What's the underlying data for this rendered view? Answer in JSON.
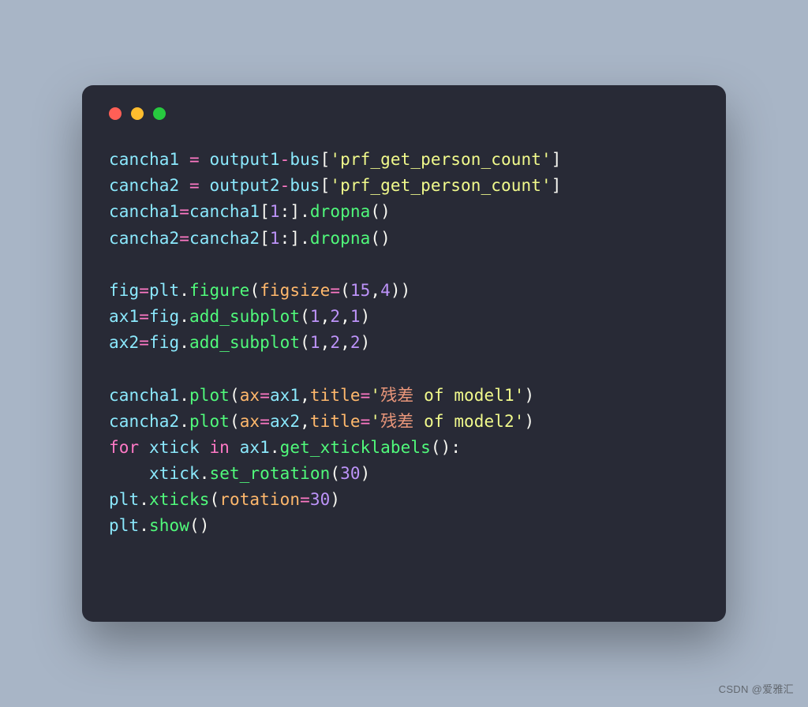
{
  "watermark": "CSDN @爱雅汇",
  "code": {
    "lines": [
      [
        {
          "t": "cancha1 ",
          "c": "c-ident"
        },
        {
          "t": "=",
          "c": "c-op"
        },
        {
          "t": " output1",
          "c": "c-ident"
        },
        {
          "t": "-",
          "c": "c-op"
        },
        {
          "t": "bus",
          "c": "c-ident"
        },
        {
          "t": "[",
          "c": "c-def"
        },
        {
          "t": "'prf_get_person_count'",
          "c": "c-str"
        },
        {
          "t": "]",
          "c": "c-def"
        }
      ],
      [
        {
          "t": "cancha2 ",
          "c": "c-ident"
        },
        {
          "t": "=",
          "c": "c-op"
        },
        {
          "t": " output2",
          "c": "c-ident"
        },
        {
          "t": "-",
          "c": "c-op"
        },
        {
          "t": "bus",
          "c": "c-ident"
        },
        {
          "t": "[",
          "c": "c-def"
        },
        {
          "t": "'prf_get_person_count'",
          "c": "c-str"
        },
        {
          "t": "]",
          "c": "c-def"
        }
      ],
      [
        {
          "t": "cancha1",
          "c": "c-ident"
        },
        {
          "t": "=",
          "c": "c-op"
        },
        {
          "t": "cancha1",
          "c": "c-ident"
        },
        {
          "t": "[",
          "c": "c-def"
        },
        {
          "t": "1",
          "c": "c-num"
        },
        {
          "t": ":].",
          "c": "c-def"
        },
        {
          "t": "dropna",
          "c": "c-call"
        },
        {
          "t": "()",
          "c": "c-def"
        }
      ],
      [
        {
          "t": "cancha2",
          "c": "c-ident"
        },
        {
          "t": "=",
          "c": "c-op"
        },
        {
          "t": "cancha2",
          "c": "c-ident"
        },
        {
          "t": "[",
          "c": "c-def"
        },
        {
          "t": "1",
          "c": "c-num"
        },
        {
          "t": ":].",
          "c": "c-def"
        },
        {
          "t": "dropna",
          "c": "c-call"
        },
        {
          "t": "()",
          "c": "c-def"
        }
      ],
      [],
      [
        {
          "t": "fig",
          "c": "c-ident"
        },
        {
          "t": "=",
          "c": "c-op"
        },
        {
          "t": "plt",
          "c": "c-ident"
        },
        {
          "t": ".",
          "c": "c-def"
        },
        {
          "t": "figure",
          "c": "c-call"
        },
        {
          "t": "(",
          "c": "c-def"
        },
        {
          "t": "figsize",
          "c": "c-kwarg"
        },
        {
          "t": "=",
          "c": "c-op"
        },
        {
          "t": "(",
          "c": "c-def"
        },
        {
          "t": "15",
          "c": "c-num"
        },
        {
          "t": ",",
          "c": "c-def"
        },
        {
          "t": "4",
          "c": "c-num"
        },
        {
          "t": "))",
          "c": "c-def"
        }
      ],
      [
        {
          "t": "ax1",
          "c": "c-ident"
        },
        {
          "t": "=",
          "c": "c-op"
        },
        {
          "t": "fig",
          "c": "c-ident"
        },
        {
          "t": ".",
          "c": "c-def"
        },
        {
          "t": "add_subplot",
          "c": "c-call"
        },
        {
          "t": "(",
          "c": "c-def"
        },
        {
          "t": "1",
          "c": "c-num"
        },
        {
          "t": ",",
          "c": "c-def"
        },
        {
          "t": "2",
          "c": "c-num"
        },
        {
          "t": ",",
          "c": "c-def"
        },
        {
          "t": "1",
          "c": "c-num"
        },
        {
          "t": ")",
          "c": "c-def"
        }
      ],
      [
        {
          "t": "ax2",
          "c": "c-ident"
        },
        {
          "t": "=",
          "c": "c-op"
        },
        {
          "t": "fig",
          "c": "c-ident"
        },
        {
          "t": ".",
          "c": "c-def"
        },
        {
          "t": "add_subplot",
          "c": "c-call"
        },
        {
          "t": "(",
          "c": "c-def"
        },
        {
          "t": "1",
          "c": "c-num"
        },
        {
          "t": ",",
          "c": "c-def"
        },
        {
          "t": "2",
          "c": "c-num"
        },
        {
          "t": ",",
          "c": "c-def"
        },
        {
          "t": "2",
          "c": "c-num"
        },
        {
          "t": ")",
          "c": "c-def"
        }
      ],
      [],
      [
        {
          "t": "cancha1",
          "c": "c-ident"
        },
        {
          "t": ".",
          "c": "c-def"
        },
        {
          "t": "plot",
          "c": "c-call"
        },
        {
          "t": "(",
          "c": "c-def"
        },
        {
          "t": "ax",
          "c": "c-kwarg"
        },
        {
          "t": "=",
          "c": "c-op"
        },
        {
          "t": "ax1",
          "c": "c-ident"
        },
        {
          "t": ",",
          "c": "c-def"
        },
        {
          "t": "title",
          "c": "c-kwarg"
        },
        {
          "t": "=",
          "c": "c-op"
        },
        {
          "t": "'",
          "c": "c-str"
        },
        {
          "t": "残差",
          "c": "c-strz"
        },
        {
          "t": " of model1'",
          "c": "c-str"
        },
        {
          "t": ")",
          "c": "c-def"
        }
      ],
      [
        {
          "t": "cancha2",
          "c": "c-ident"
        },
        {
          "t": ".",
          "c": "c-def"
        },
        {
          "t": "plot",
          "c": "c-call"
        },
        {
          "t": "(",
          "c": "c-def"
        },
        {
          "t": "ax",
          "c": "c-kwarg"
        },
        {
          "t": "=",
          "c": "c-op"
        },
        {
          "t": "ax2",
          "c": "c-ident"
        },
        {
          "t": ",",
          "c": "c-def"
        },
        {
          "t": "title",
          "c": "c-kwarg"
        },
        {
          "t": "=",
          "c": "c-op"
        },
        {
          "t": "'",
          "c": "c-str"
        },
        {
          "t": "残差",
          "c": "c-strz"
        },
        {
          "t": " of model2'",
          "c": "c-str"
        },
        {
          "t": ")",
          "c": "c-def"
        }
      ],
      [
        {
          "t": "for",
          "c": "c-op"
        },
        {
          "t": " xtick ",
          "c": "c-ident"
        },
        {
          "t": "in",
          "c": "c-op"
        },
        {
          "t": " ax1",
          "c": "c-ident"
        },
        {
          "t": ".",
          "c": "c-def"
        },
        {
          "t": "get_xticklabels",
          "c": "c-call"
        },
        {
          "t": "():",
          "c": "c-def"
        }
      ],
      [
        {
          "t": "    xtick",
          "c": "c-ident"
        },
        {
          "t": ".",
          "c": "c-def"
        },
        {
          "t": "set_rotation",
          "c": "c-call"
        },
        {
          "t": "(",
          "c": "c-def"
        },
        {
          "t": "30",
          "c": "c-num"
        },
        {
          "t": ")",
          "c": "c-def"
        }
      ],
      [
        {
          "t": "plt",
          "c": "c-ident"
        },
        {
          "t": ".",
          "c": "c-def"
        },
        {
          "t": "xticks",
          "c": "c-call"
        },
        {
          "t": "(",
          "c": "c-def"
        },
        {
          "t": "rotation",
          "c": "c-kwarg"
        },
        {
          "t": "=",
          "c": "c-op"
        },
        {
          "t": "30",
          "c": "c-num"
        },
        {
          "t": ")",
          "c": "c-def"
        }
      ],
      [
        {
          "t": "plt",
          "c": "c-ident"
        },
        {
          "t": ".",
          "c": "c-def"
        },
        {
          "t": "show",
          "c": "c-call"
        },
        {
          "t": "()",
          "c": "c-def"
        }
      ]
    ]
  }
}
